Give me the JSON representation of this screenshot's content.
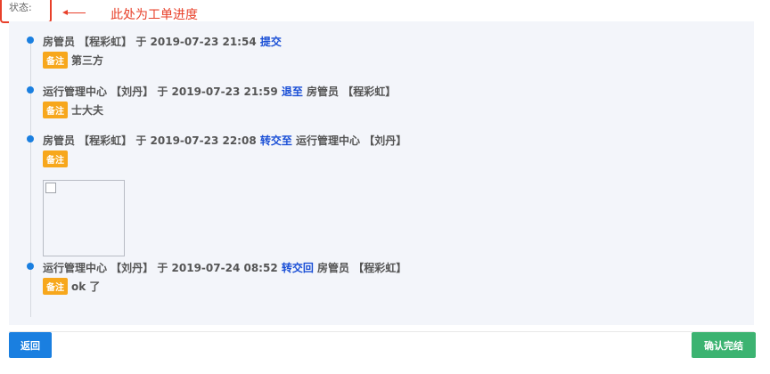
{
  "status": {
    "label": "状态:"
  },
  "annotation": {
    "text": "此处为工单进度"
  },
  "timeline": {
    "entries": [
      {
        "prefix": "房管员 【程彩虹】 于 2019-07-23 21:54 ",
        "action": "提交",
        "suffix": "",
        "badge": "备注",
        "note": "第三方"
      },
      {
        "prefix": "运行管理中心 【刘丹】 于 2019-07-23 21:59 ",
        "action": "退至",
        "suffix": " 房管员 【程彩虹】",
        "badge": "备注",
        "note": "士大夫"
      },
      {
        "prefix": "房管员 【程彩虹】 于 2019-07-23 22:08 ",
        "action": "转交至",
        "suffix": " 运行管理中心 【刘丹】",
        "badge": "备注",
        "note": ""
      },
      {
        "prefix": "运行管理中心 【刘丹】 于 2019-07-24 08:52 ",
        "action": "转交回",
        "suffix": " 房管员 【程彩虹】",
        "badge": "备注",
        "note": "ok 了"
      }
    ]
  },
  "buttons": {
    "back": "返回",
    "confirm": "确认完结"
  },
  "colors": {
    "accent": "#1a7fe0",
    "action": "#1a4fd6",
    "badge": "#f7a71c",
    "confirm": "#3cb371",
    "annotation": "#e8402a"
  },
  "icons": {
    "attachment": "broken-image-icon"
  }
}
